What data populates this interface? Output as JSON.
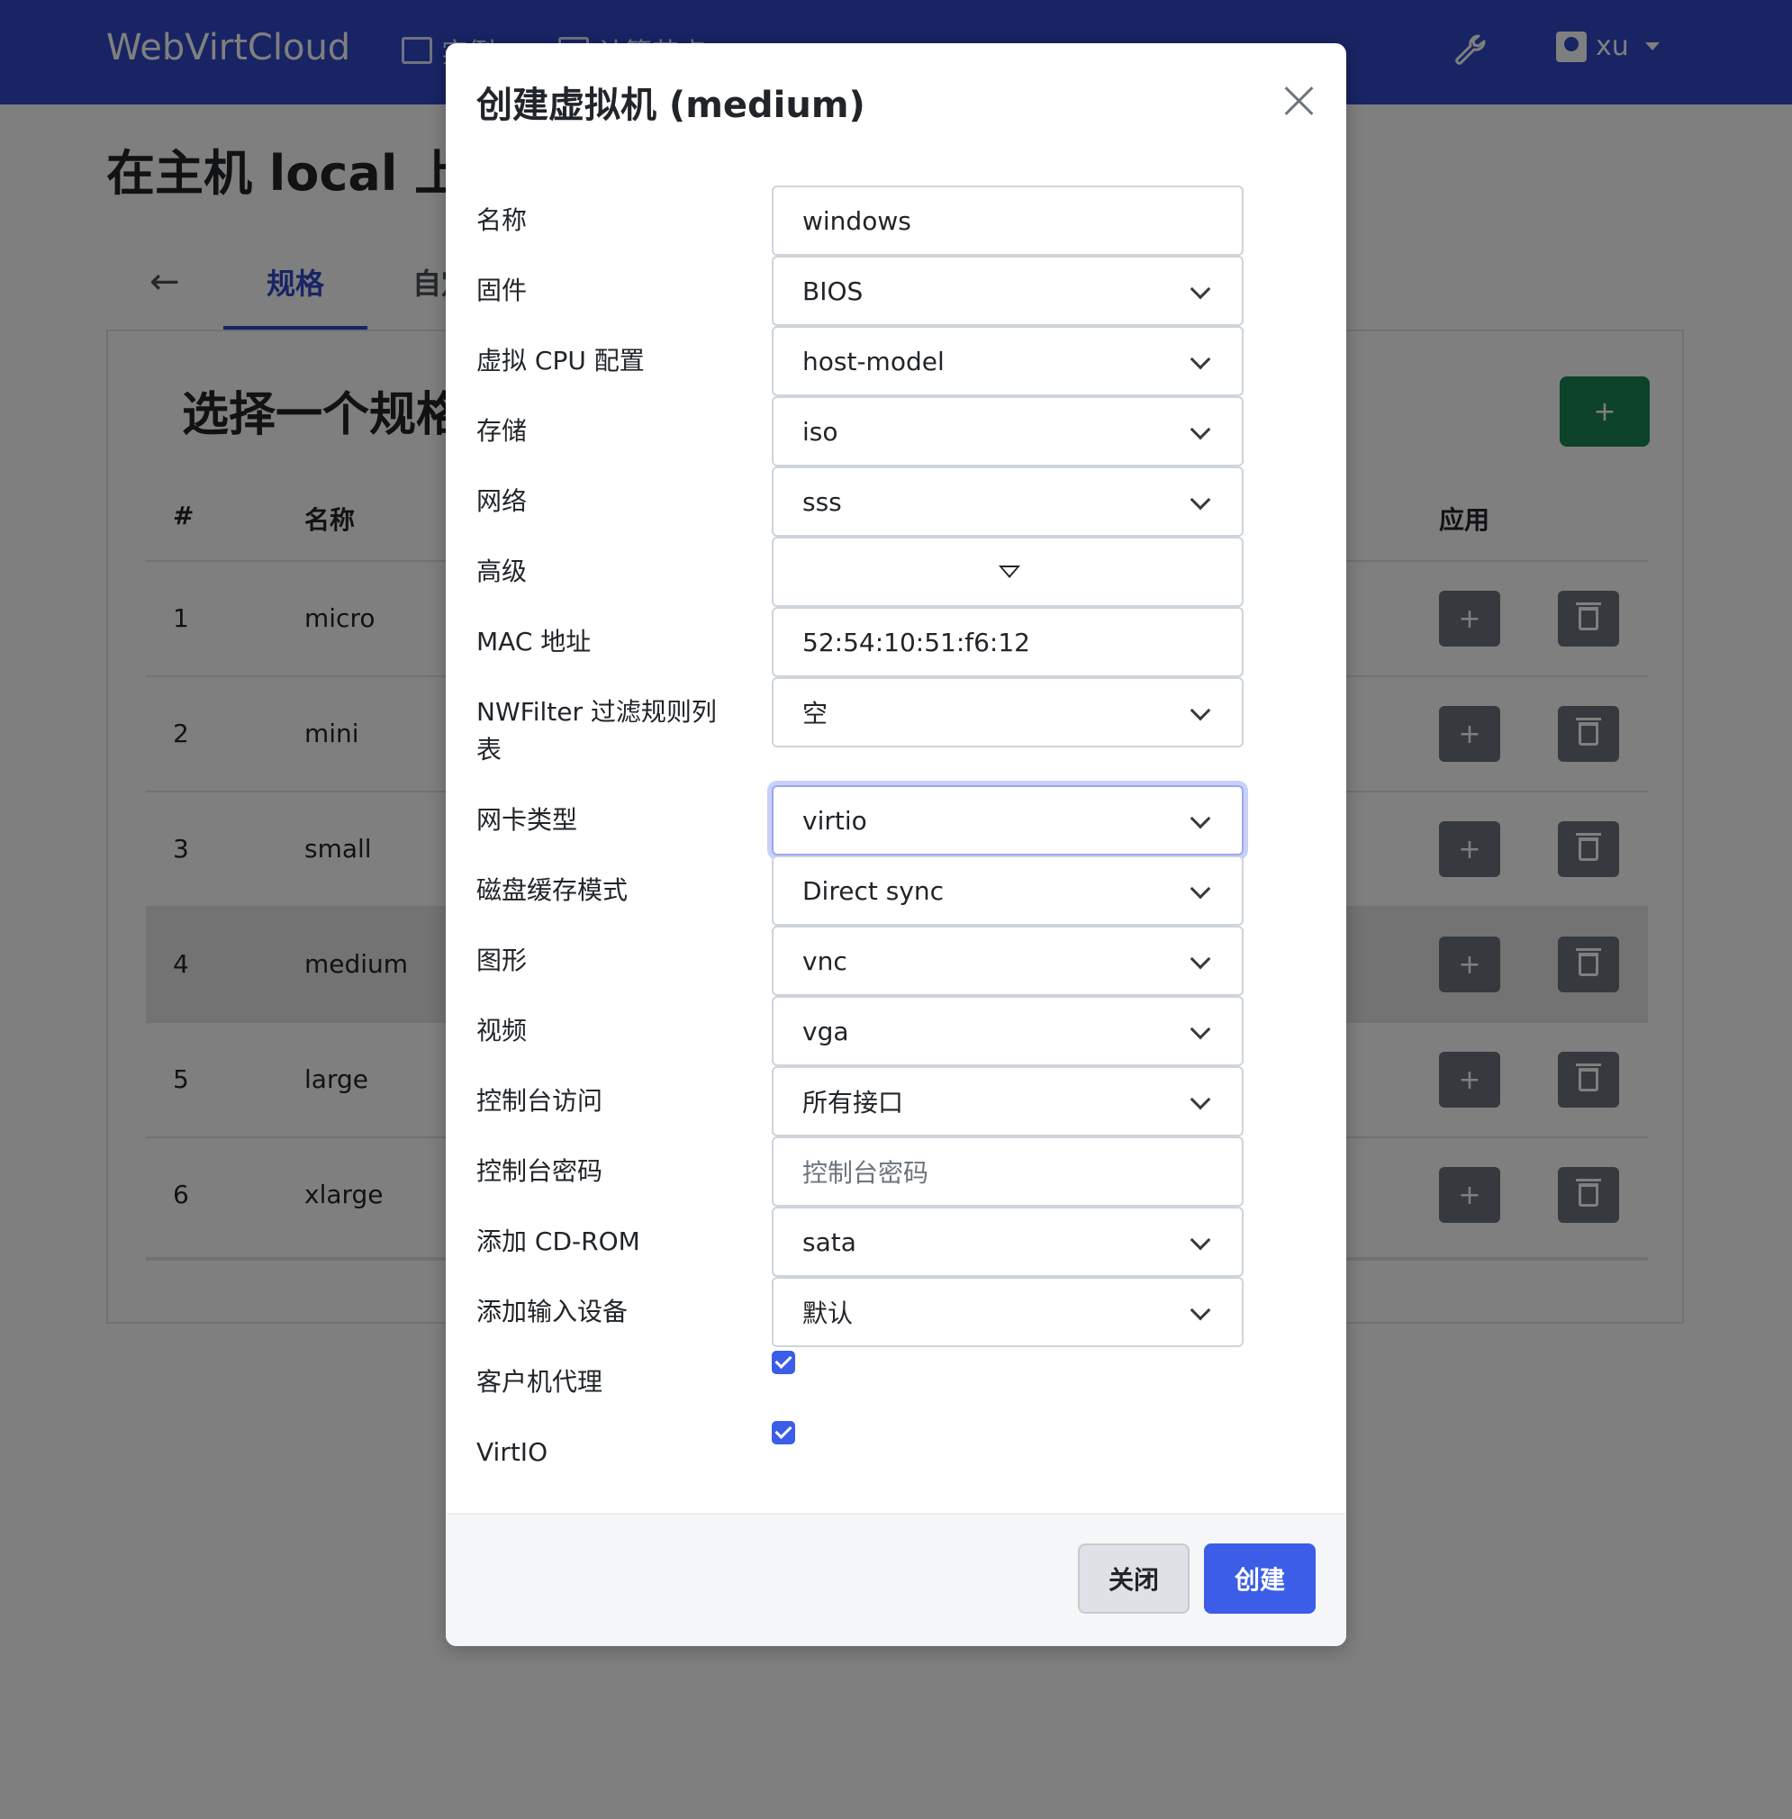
{
  "navbar": {
    "brand": "WebVirtCloud",
    "link_instances": "实例",
    "link_compute": "计算节点",
    "tools_icon": "wrench-icon",
    "user": "xu"
  },
  "page": {
    "title": "在主机 local 上创建虚拟机",
    "tab_back": "←",
    "tab_flavor": "规格",
    "tab_custom": "自定义"
  },
  "card": {
    "title": "选择一个规格",
    "add_label": "+",
    "headers": {
      "index": "#",
      "name": "名称",
      "apply": "应用"
    },
    "rows": [
      {
        "index": "1",
        "name": "micro",
        "apply": "+"
      },
      {
        "index": "2",
        "name": "mini",
        "apply": "+"
      },
      {
        "index": "3",
        "name": "small",
        "apply": "+"
      },
      {
        "index": "4",
        "name": "medium",
        "apply": "+"
      },
      {
        "index": "5",
        "name": "large",
        "apply": "+"
      },
      {
        "index": "6",
        "name": "xlarge",
        "apply": "+"
      }
    ]
  },
  "modal": {
    "title": "创建虚拟机 (medium)",
    "fields": {
      "name": {
        "label": "名称",
        "value": "windows"
      },
      "firmware": {
        "label": "固件",
        "value": "BIOS"
      },
      "cpu": {
        "label": "虚拟 CPU 配置",
        "value": "host-model"
      },
      "storage": {
        "label": "存储",
        "value": "iso"
      },
      "network": {
        "label": "网络",
        "value": "sss"
      },
      "advanced": {
        "label": "高级"
      },
      "mac": {
        "label": "MAC 地址",
        "value": "52:54:10:51:f6:12"
      },
      "nwfilter": {
        "label": "NWFilter 过滤规则列表",
        "value": "空"
      },
      "nic": {
        "label": "网卡类型",
        "value": "virtio"
      },
      "cache": {
        "label": "磁盘缓存模式",
        "value": "Direct sync"
      },
      "graphics": {
        "label": "图形",
        "value": "vnc"
      },
      "video": {
        "label": "视频",
        "value": "vga"
      },
      "console_access": {
        "label": "控制台访问",
        "value": "所有接口"
      },
      "console_password": {
        "label": "控制台密码",
        "placeholder": "控制台密码"
      },
      "cdrom": {
        "label": "添加 CD-ROM",
        "value": "sata"
      },
      "input_device": {
        "label": "添加输入设备",
        "value": "默认"
      },
      "guest_agent": {
        "label": "客户机代理",
        "checked": true
      },
      "virtio": {
        "label": "VirtIO",
        "checked": true
      }
    },
    "close_label": "关闭",
    "create_label": "创建"
  },
  "colors": {
    "navbar": "#3048c8",
    "primary": "#3b5de7",
    "success": "#198754",
    "secondary": "#6c757d"
  }
}
